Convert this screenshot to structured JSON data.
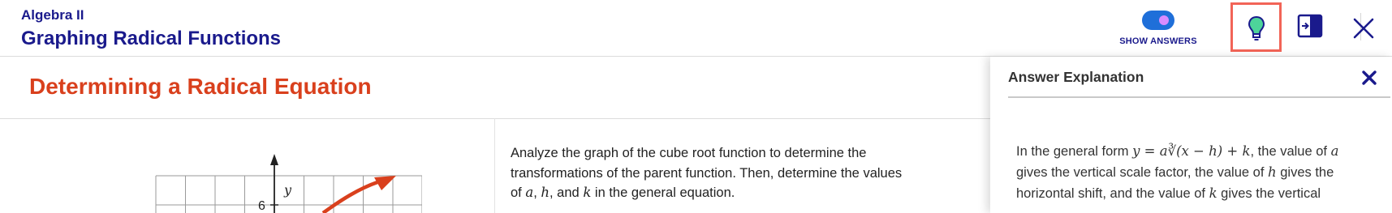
{
  "header": {
    "course": "Algebra II",
    "lesson": "Graphing Radical Functions",
    "show_answers_label": "SHOW ANSWERS",
    "show_answers_on": true
  },
  "section": {
    "title": "Determining a Radical Equation"
  },
  "graph": {
    "y_axis_label": "y",
    "y_tick_label": "6"
  },
  "instructions": {
    "part1": "Analyze the graph of the cube root function to determine the transformations of the parent function. Then, determine the values of ",
    "var_a": "a",
    "comma1": ", ",
    "var_h": "h",
    "and_text": ", and ",
    "var_k": "k",
    "part2": " in the general equation."
  },
  "answer_panel": {
    "title": "Answer Explanation",
    "explanation": {
      "lead": "In the general form ",
      "formula": "y = a∛(x − h) + k",
      "after_formula": ", the value of ",
      "var_a": "a",
      "text2": " gives the vertical scale factor, the value of ",
      "var_h": "h",
      "text3": " gives the horizontal shift, and the value of ",
      "var_k": "k",
      "text4": " gives the vertical"
    }
  },
  "colors": {
    "brand_blue": "#1a1a8c",
    "section_title": "#d9401d",
    "toggle_on": "#1f6fd9",
    "hint_highlight": "#f26457",
    "curve": "#d9401d"
  },
  "icons": [
    "lightbulb-icon",
    "side-panel-icon",
    "close-icon",
    "panel-close-icon"
  ]
}
